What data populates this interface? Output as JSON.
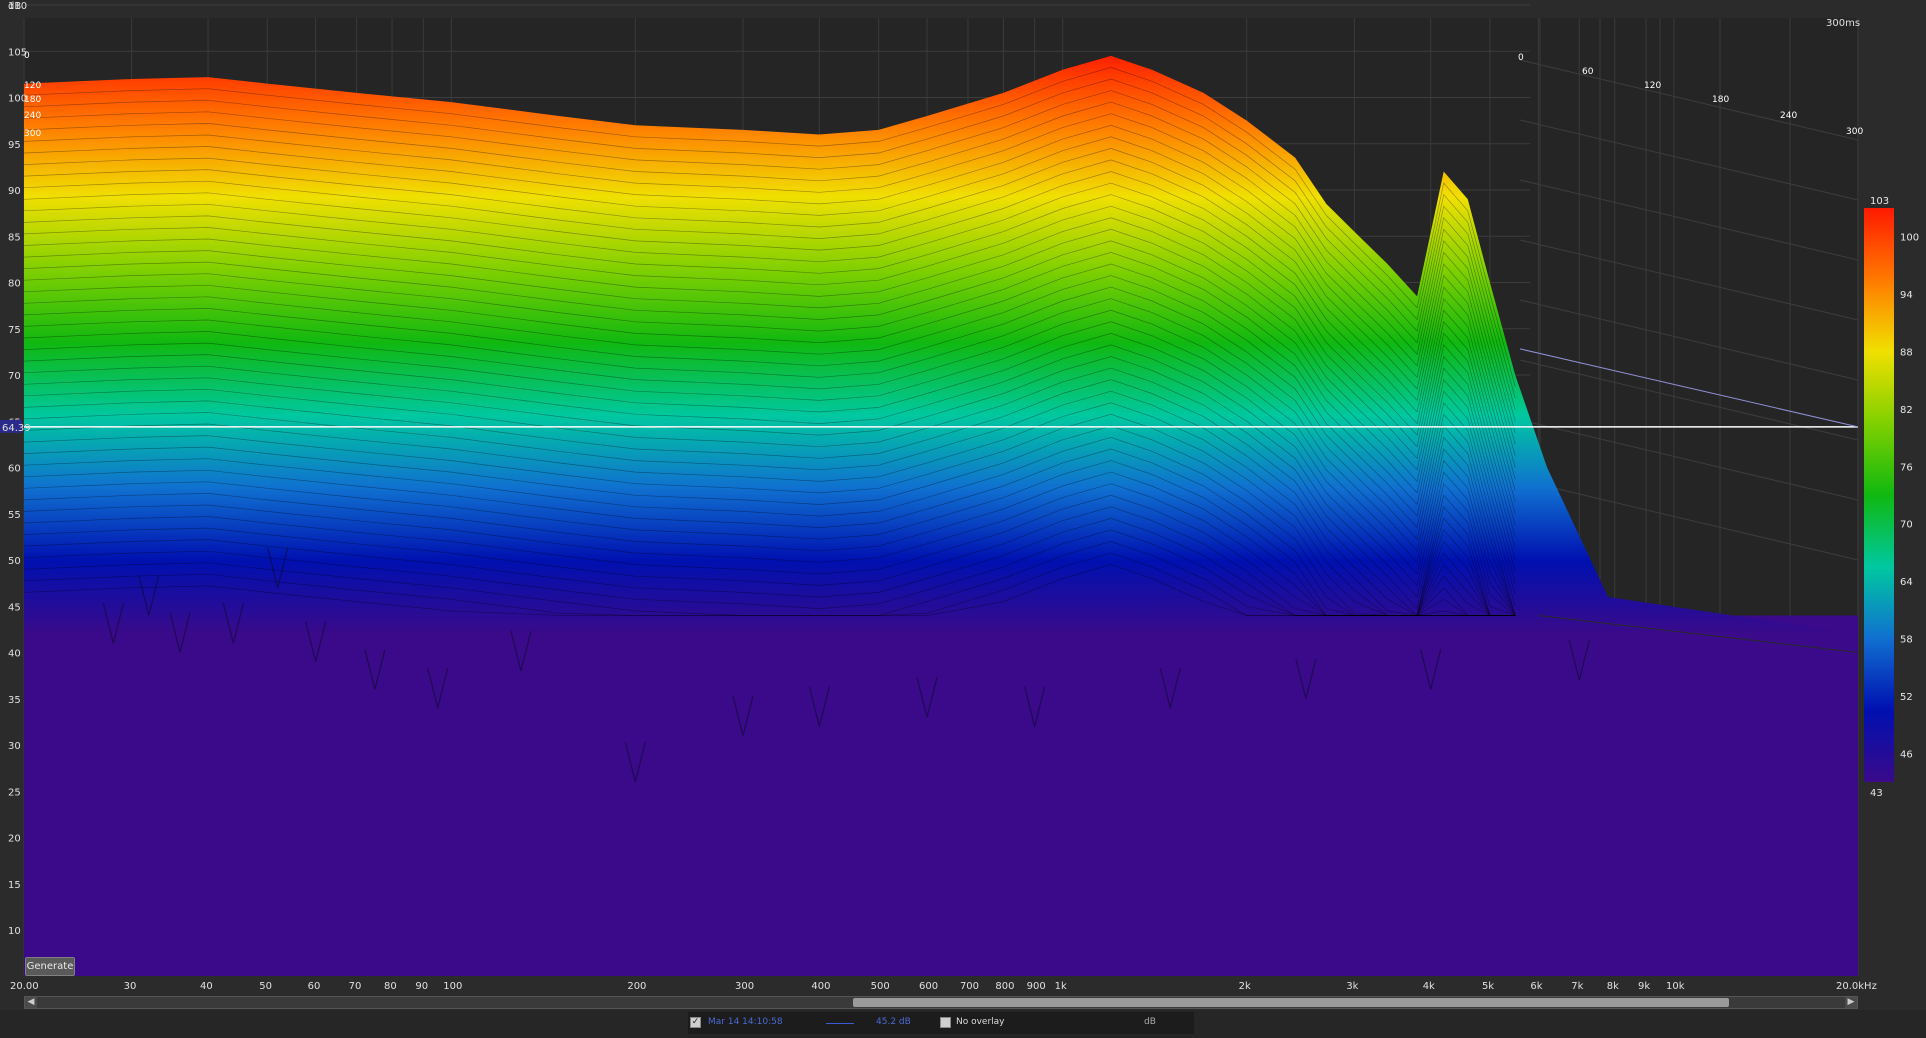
{
  "chart_data": {
    "type": "waterfall",
    "ylabel": "dB",
    "y_ticks": [
      "110",
      "105",
      "100",
      "95",
      "90",
      "85",
      "80",
      "75",
      "70",
      "65",
      "60",
      "55",
      "50",
      "45",
      "40",
      "35",
      "30",
      "25",
      "20",
      "15",
      "10"
    ],
    "ylim": [
      8,
      111
    ],
    "x_scale": "log",
    "xlim": [
      20,
      20000
    ],
    "x_ticks": [
      {
        "value": 20,
        "label": "20.00"
      },
      {
        "value": 30,
        "label": "30"
      },
      {
        "value": 40,
        "label": "40"
      },
      {
        "value": 50,
        "label": "50"
      },
      {
        "value": 60,
        "label": "60"
      },
      {
        "value": 70,
        "label": "70"
      },
      {
        "value": 80,
        "label": "80"
      },
      {
        "value": 90,
        "label": "90"
      },
      {
        "value": 100,
        "label": "100"
      },
      {
        "value": 200,
        "label": "200"
      },
      {
        "value": 300,
        "label": "300"
      },
      {
        "value": 400,
        "label": "400"
      },
      {
        "value": 500,
        "label": "500"
      },
      {
        "value": 600,
        "label": "600"
      },
      {
        "value": 700,
        "label": "700"
      },
      {
        "value": 800,
        "label": "800"
      },
      {
        "value": 900,
        "label": "900"
      },
      {
        "value": 1000,
        "label": "1k"
      },
      {
        "value": 2000,
        "label": "2k"
      },
      {
        "value": 3000,
        "label": "3k"
      },
      {
        "value": 4000,
        "label": "4k"
      },
      {
        "value": 5000,
        "label": "5k"
      },
      {
        "value": 6000,
        "label": "6k"
      },
      {
        "value": 7000,
        "label": "7k"
      },
      {
        "value": 8000,
        "label": "8k"
      },
      {
        "value": 9000,
        "label": "9k"
      },
      {
        "value": 10000,
        "label": "10k"
      },
      {
        "value": 20000,
        "label": "20.0kHz"
      }
    ],
    "time_axis_label": "300ms",
    "time_ticks": [
      "0",
      "60",
      "120",
      "180",
      "240",
      "300"
    ],
    "time_ticks_left": [
      "0",
      "120",
      "180",
      "240",
      "300"
    ],
    "cursor_value": "64.39",
    "front_response": {
      "freq": [
        20,
        30,
        40,
        50,
        70,
        100,
        150,
        200,
        300,
        400,
        500,
        600,
        800,
        1000,
        1200,
        1400,
        1700,
        2000,
        2400,
        2700,
        3000,
        3400,
        3800,
        4200,
        4600,
        5000,
        5500
      ],
      "db": [
        101.5,
        102,
        102.2,
        101.5,
        100.5,
        99.5,
        98,
        97,
        96.5,
        96,
        96.5,
        98,
        100.5,
        103,
        104.5,
        103,
        100.5,
        97.5,
        93.5,
        88.5,
        85.5,
        82,
        78.5,
        92,
        89,
        80,
        70
      ]
    },
    "colorbar": {
      "min_label": "43",
      "max_label": "103",
      "ticks": [
        "100",
        "94",
        "88",
        "82",
        "76",
        "70",
        "64",
        "58",
        "52",
        "46"
      ],
      "colors": [
        "#ff1a00",
        "#ff7a00",
        "#f0e000",
        "#80d000",
        "#10b810",
        "#00c8a0",
        "#1070d0",
        "#0010b0",
        "#3a0a8a"
      ]
    }
  },
  "controls": {
    "generate_label": "Generate"
  },
  "footer": {
    "measurement_name": "Mar 14 14:10:58",
    "measurement_value": "45.2 dB",
    "overlay_label": "No overlay",
    "unit_label": "dB",
    "measurement_checked": "✓"
  }
}
